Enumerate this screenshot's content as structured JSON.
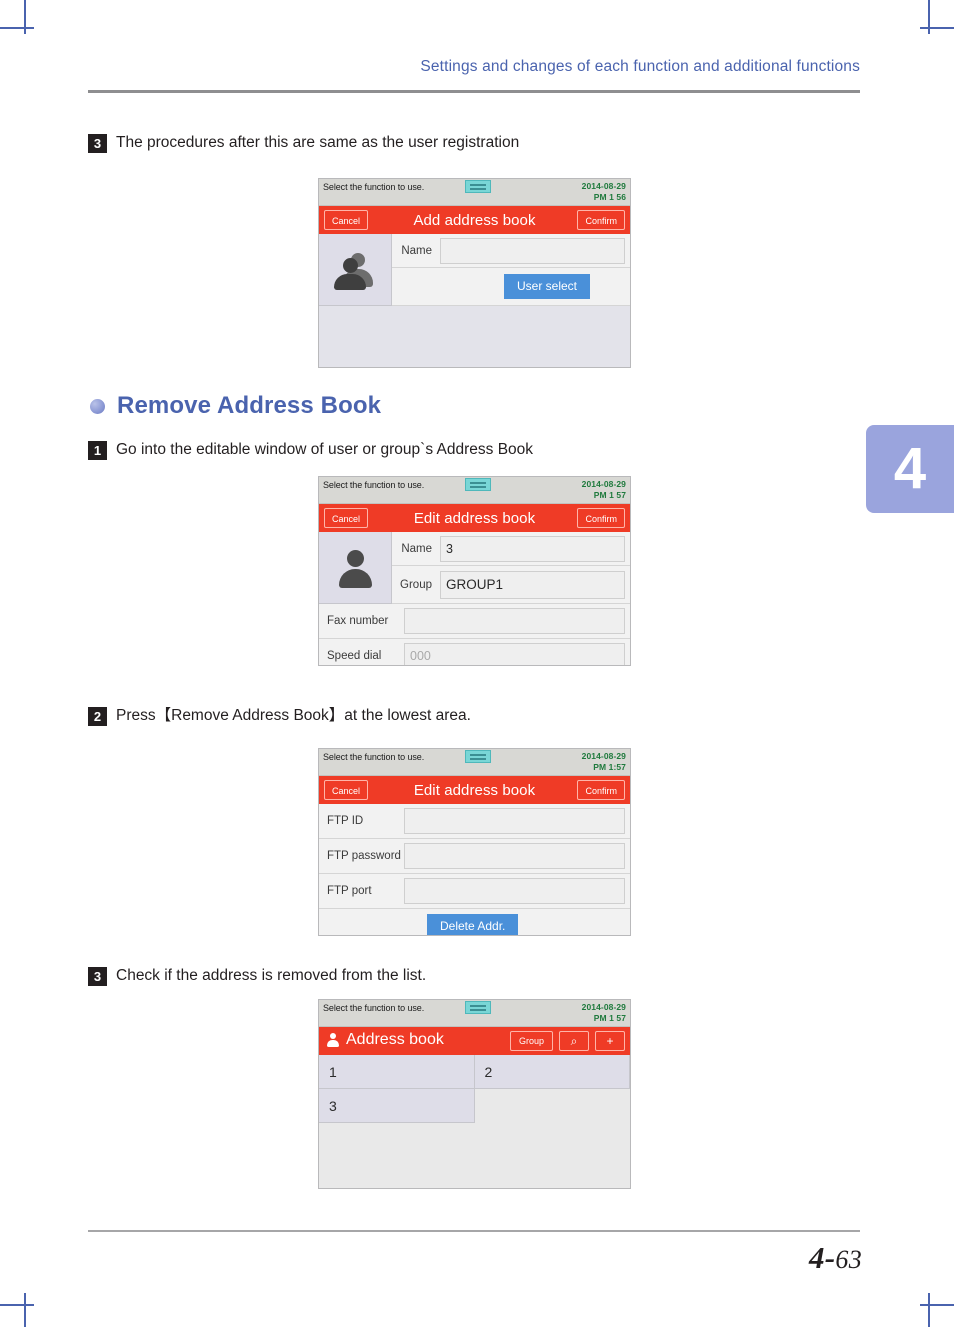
{
  "page": {
    "header_title": "Settings and changes of each function and additional functions",
    "chapter_tab": "4",
    "page_number_major": "4-",
    "page_number_minor": "63"
  },
  "steps": {
    "step_a": {
      "badge": "3",
      "text": "The procedures after this are same as the user registration"
    },
    "step_1": {
      "badge": "1",
      "text": "Go into the editable window of user or group`s Address Book"
    },
    "step_2": {
      "badge": "2",
      "text": "Press【Remove Address Book】at the lowest area."
    },
    "step_3": {
      "badge": "3",
      "text": "Check if the address is removed from the list."
    }
  },
  "section": {
    "heading": "Remove Address Book"
  },
  "screens": {
    "add_address_book": {
      "status": {
        "hint": "Select the function to use.",
        "date": "2014-08-29",
        "time": "PM 1  56"
      },
      "titlebar": {
        "cancel": "Cancel",
        "title": "Add address book",
        "confirm": "Confirm"
      },
      "name_label": "Name",
      "name_value": "",
      "user_select_label": "User select"
    },
    "edit_address_book_1": {
      "status": {
        "hint": "Select the function to use.",
        "date": "2014-08-29",
        "time": "PM 1  57"
      },
      "titlebar": {
        "cancel": "Cancel",
        "title": "Edit address book",
        "confirm": "Confirm"
      },
      "fields": [
        {
          "label": "Name",
          "value": "3",
          "placeholder": ""
        },
        {
          "label": "Group",
          "value": "GROUP1",
          "placeholder": ""
        },
        {
          "label": "Fax number",
          "value": "",
          "placeholder": ""
        },
        {
          "label": "Speed dial",
          "value": "",
          "placeholder": "000"
        }
      ]
    },
    "edit_address_book_2": {
      "status": {
        "hint": "Select the function to use.",
        "date": "2014-08-29",
        "time": "PM 1:57"
      },
      "titlebar": {
        "cancel": "Cancel",
        "title": "Edit address book",
        "confirm": "Confirm"
      },
      "fields": [
        {
          "label": "FTP ID",
          "value": ""
        },
        {
          "label": "FTP password",
          "value": ""
        },
        {
          "label": "FTP port",
          "value": ""
        }
      ],
      "delete_label": "Delete Addr."
    },
    "address_book_list": {
      "status": {
        "hint": "Select the function to use.",
        "date": "2014-08-29",
        "time": "PM 1  57"
      },
      "titlebar": {
        "title": "Address book",
        "group_label": "Group",
        "search_icon": "⌕",
        "add_icon": "+"
      },
      "entries": [
        "1",
        "2",
        "3"
      ]
    }
  },
  "colors": {
    "accent_red": "#ef3b26",
    "accent_blue": "#4a90d9",
    "heading_blue": "#4a63ae",
    "chapter_tab": "#9aa4dd",
    "status_green": "#1f7a3d",
    "status_teal": "#79d6d6"
  }
}
